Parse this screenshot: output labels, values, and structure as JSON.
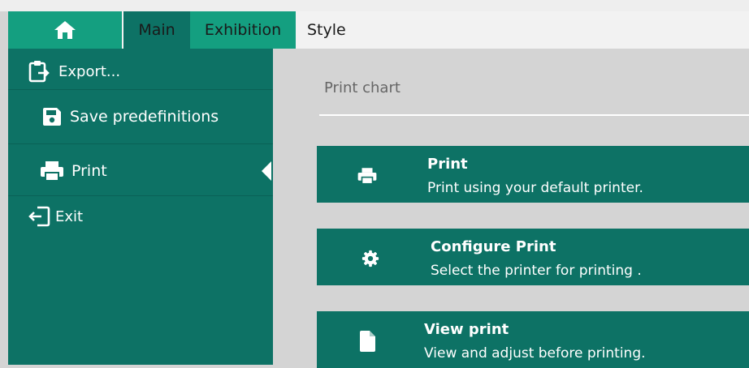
{
  "tabs": {
    "home_icon": "home-icon",
    "main": "Main",
    "exhibition": "Exhibition",
    "style": "Style"
  },
  "sidebar": {
    "items": [
      {
        "label": "Export...",
        "icon": "clipboard-export-icon"
      },
      {
        "label": "Save predefinitions",
        "icon": "save-icon"
      },
      {
        "label": "Print",
        "icon": "printer-icon",
        "selected": true
      },
      {
        "label": "Exit",
        "icon": "exit-icon"
      }
    ]
  },
  "main": {
    "section_title": "Print chart",
    "cards": [
      {
        "title": "Print",
        "description": "Print using your default printer.",
        "icon": "printer-icon"
      },
      {
        "title": "Configure Print",
        "description": "Select the printer for printing .",
        "icon": "gear-icon"
      },
      {
        "title": "View print",
        "description": "View and adjust before printing.",
        "icon": "document-icon"
      }
    ]
  },
  "colors": {
    "teal_dark": "#0d7265",
    "teal_bright": "#149f80",
    "background": "#d4d4d4"
  }
}
